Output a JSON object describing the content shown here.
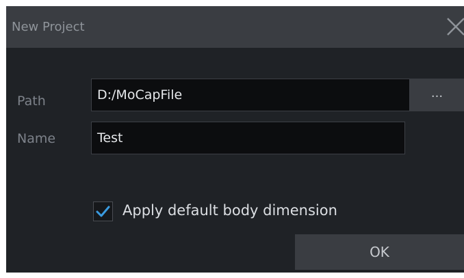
{
  "dialog": {
    "title": "New Project",
    "close_icon": "close-icon"
  },
  "form": {
    "path_label": "Path",
    "path_value": "D:/MoCapFile",
    "browse_label": "...",
    "name_label": "Name",
    "name_value": "Test"
  },
  "options": {
    "apply_default_checked": true,
    "apply_default_label": "Apply default body dimension"
  },
  "actions": {
    "ok_label": "OK"
  },
  "colors": {
    "check_accent": "#3a9be0",
    "dialog_bg": "#1f2226",
    "titlebar_bg": "#3a3d42"
  }
}
